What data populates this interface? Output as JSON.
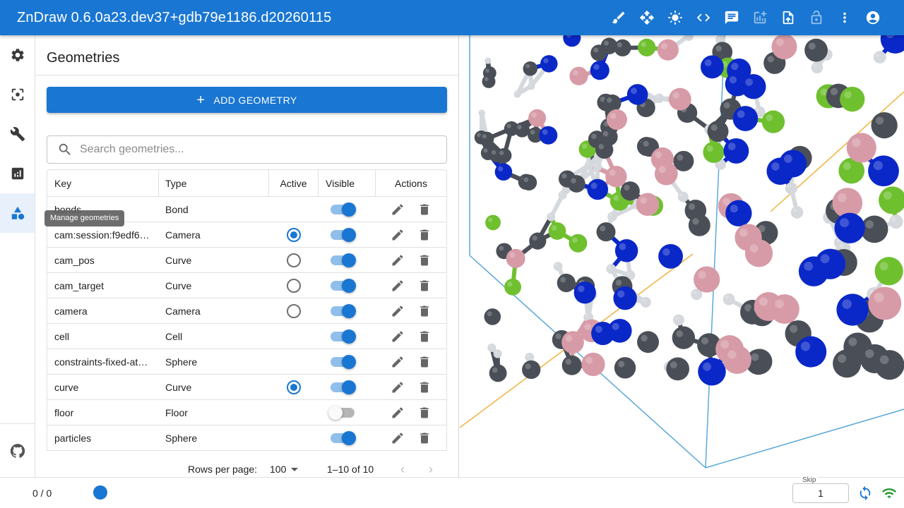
{
  "app": {
    "title": "ZnDraw 0.6.0a23.dev37+gdb79e1186.d20260115"
  },
  "toolbar": {
    "icons": [
      "brush-icon",
      "move-icon",
      "brightness-icon",
      "code-icon",
      "chat-icon",
      "add-chart-icon",
      "upload-file-icon",
      "lock-icon",
      "more-vert-icon",
      "account-circle-icon"
    ]
  },
  "rail": {
    "items": [
      "settings-icon",
      "center-focus-icon",
      "build-icon",
      "analytics-icon",
      "geometry-shapes-icon"
    ],
    "selected": "geometry-shapes-icon",
    "tooltip": "Manage geometries",
    "bottom_icon": "github-icon"
  },
  "panel": {
    "title": "Geometries",
    "add_button": "ADD GEOMETRY",
    "search_placeholder": "Search geometries...",
    "columns": {
      "key": "Key",
      "type": "Type",
      "active": "Active",
      "visible": "Visible",
      "actions": "Actions"
    },
    "rows": [
      {
        "key": "bonds",
        "type": "Bond",
        "active": null,
        "visible": true
      },
      {
        "key": "cam:session:f9edf6…",
        "type": "Camera",
        "active": true,
        "visible": true
      },
      {
        "key": "cam_pos",
        "type": "Curve",
        "active": false,
        "visible": true
      },
      {
        "key": "cam_target",
        "type": "Curve",
        "active": false,
        "visible": true
      },
      {
        "key": "camera",
        "type": "Camera",
        "active": false,
        "visible": true
      },
      {
        "key": "cell",
        "type": "Cell",
        "active": null,
        "visible": true
      },
      {
        "key": "constraints-fixed-at…",
        "type": "Sphere",
        "active": null,
        "visible": true
      },
      {
        "key": "curve",
        "type": "Curve",
        "active": true,
        "visible": true
      },
      {
        "key": "floor",
        "type": "Floor",
        "active": null,
        "visible": false
      },
      {
        "key": "particles",
        "type": "Sphere",
        "active": null,
        "visible": true
      }
    ],
    "pagination": {
      "rows_per_page_label": "Rows per page:",
      "rows_per_page": "100",
      "range": "1–10 of 10"
    }
  },
  "bottom": {
    "frame": "0 / 0",
    "skip_label": "Skip",
    "skip_value": "1"
  },
  "colors": {
    "primary": "#1976d2",
    "carbon": "#4a4f57",
    "hydrogen": "#d5d8dc",
    "nitrogen": "#0a28c8",
    "fluorine": "#6fc02f",
    "boron": "#d79ba7",
    "cell": "#5aa8d8",
    "axis": "#f0b23c"
  }
}
